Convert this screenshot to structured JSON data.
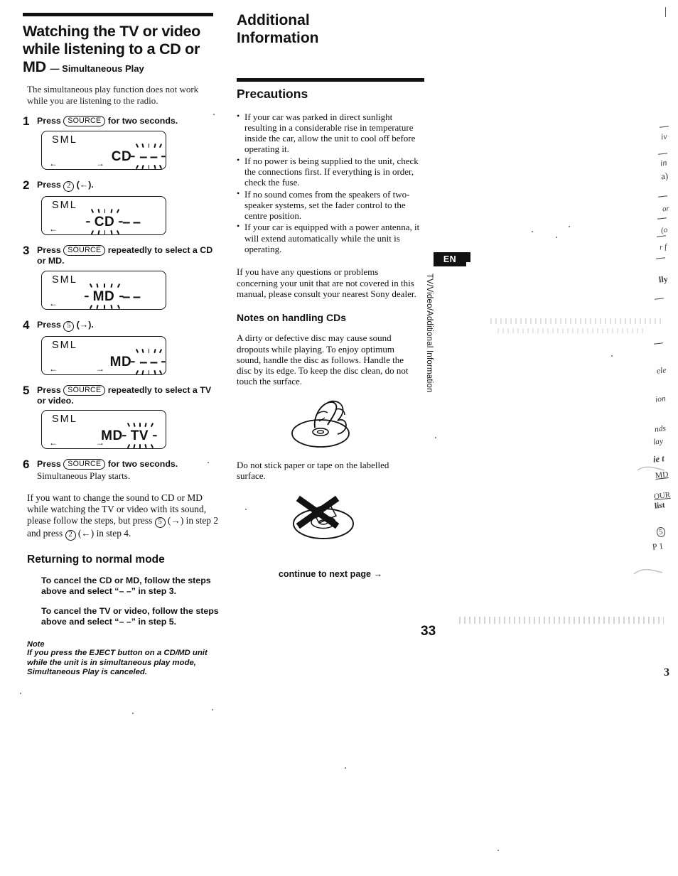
{
  "document": {
    "page_number": "33",
    "language_badge": "EN",
    "side_tab_label": "TV/Video/Additional Information",
    "corner_mark": "3"
  },
  "left_column": {
    "heading_line1": "Watching the TV or video",
    "heading_line2": "while listening to a CD or",
    "heading_line3_main": "MD",
    "heading_line3_sub": "— Simultaneous Play",
    "intro": "The simultaneous play function does not work while you are listening to the radio.",
    "steps": [
      {
        "number": "1",
        "text_before": "Press",
        "button": "SOURCE",
        "button_type": "pill",
        "text_after": "for two seconds.",
        "sub_text": "",
        "display": {
          "label": "SML",
          "seg_left": "CD",
          "seg_left_flash": false,
          "seg_right": "– –",
          "seg_right_flash": true,
          "arrow_left": "←",
          "arrow_right": "→"
        }
      },
      {
        "number": "2",
        "text_before": "Press",
        "button": "2",
        "button_type": "circle",
        "text_after": "(←).",
        "sub_text": "",
        "display": {
          "label": "SML",
          "seg_left": "CD",
          "seg_left_flash": true,
          "seg_right": "– –",
          "seg_right_flash": false,
          "arrow_left": "←",
          "arrow_right": ""
        }
      },
      {
        "number": "3",
        "text_before": "Press",
        "button": "SOURCE",
        "button_type": "pill",
        "text_after": "repeatedly to select a CD or MD.",
        "sub_text": "",
        "display": {
          "label": "SML",
          "seg_left": "MD",
          "seg_left_flash": true,
          "seg_right": "– –",
          "seg_right_flash": false,
          "arrow_left": "←",
          "arrow_right": ""
        }
      },
      {
        "number": "4",
        "text_before": "Press",
        "button": "5",
        "button_type": "circle",
        "text_after": "(→).",
        "sub_text": "",
        "display": {
          "label": "SML",
          "seg_left": "MD",
          "seg_left_flash": false,
          "seg_right": "– –",
          "seg_right_flash": true,
          "arrow_left": "←",
          "arrow_right": "→"
        }
      },
      {
        "number": "5",
        "text_before": "Press",
        "button": "SOURCE",
        "button_type": "pill",
        "text_after": "repeatedly to select a TV or video.",
        "sub_text": "",
        "display": {
          "label": "SML",
          "seg_left": "MD",
          "seg_left_flash": false,
          "seg_right": "TV",
          "seg_right_flash": true,
          "arrow_left": "←",
          "arrow_right": "→"
        }
      },
      {
        "number": "6",
        "text_before": "Press",
        "button": "SOURCE",
        "button_type": "pill",
        "text_after": "for two seconds.",
        "sub_text": "Simultaneous Play starts.",
        "display": null
      }
    ],
    "change_sound_para_part1": "If you want to change the sound to CD or MD while watching the TV or video with its sound, please follow the steps, but press",
    "change_sound_btn1": "5",
    "change_sound_para_part2": "(→) in step 2 and press",
    "change_sound_btn2": "2",
    "change_sound_para_part3": "(←) in step 4.",
    "returning_heading": "Returning to normal mode",
    "cancel_cd_md": "To cancel the CD or MD, follow the steps above and select “– –” in step 3.",
    "cancel_tv_video": "To cancel the TV or video, follow the steps above and select “– –” in step 5.",
    "note_title": "Note",
    "note_body": "If you press the EJECT button on a CD/MD unit while the unit is in simultaneous play mode, Simultaneous Play is canceled."
  },
  "right_column": {
    "section_title_line1": "Additional",
    "section_title_line2": "Information",
    "precautions_heading": "Precautions",
    "precautions": [
      "If your car was parked in direct sunlight resulting in a considerable rise in temperature inside the car, allow the unit to cool off before operating it.",
      "If no power is being supplied to the unit, check the connections first. If everything is in order, check the fuse.",
      "If no sound comes from the speakers of two-speaker systems, set the fader control to the centre position.",
      "If your car is equipped with a power antenna, it will extend automatically while the unit is operating."
    ],
    "dealer_para": "If you have any questions or problems concerning your unit that are not covered in this manual, please consult your nearest Sony dealer.",
    "notes_cds_heading": "Notes on handling CDs",
    "notes_cds_body": "A dirty or defective disc may cause sound dropouts while playing. To enjoy optimum sound, handle the disc as follows. Handle the disc by its edge. To keep the disc clean, do not touch the surface.",
    "label_caption": "Do not stick paper or tape on the labelled surface.",
    "continue_text": "continue to next page →",
    "illustration_1": "hand-holding-disc-by-edge",
    "illustration_2": "disc-with-sticker-crossed-out"
  },
  "scan_artifacts": {
    "right_margin_fragments": [
      "iv",
      "in",
      "a)",
      "or",
      "(o",
      "r f",
      "lly",
      "ele",
      "ion",
      "nds",
      "lay",
      "ie t",
      "MD",
      "OUR",
      "list",
      "5",
      "P 1"
    ]
  }
}
